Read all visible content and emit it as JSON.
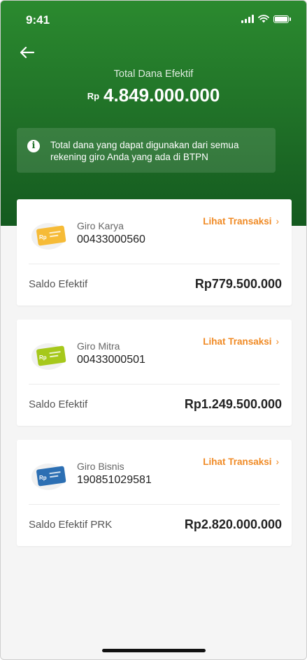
{
  "status_bar": {
    "time": "9:41"
  },
  "header": {
    "total_label": "Total Dana Efektif",
    "currency": "Rp",
    "total_amount": "4.849.000.000",
    "info_text": "Total dana yang dapat digunakan dari semua rekening giro Anda yang ada di BTPN"
  },
  "accounts": [
    {
      "name": "Giro Karya",
      "number": "00433000560",
      "link_label": "Lihat Transaksi",
      "saldo_label": "Saldo Efektif",
      "saldo_value": "Rp779.500.000",
      "card_color": "#f5b21c",
      "card_badge": "Rp"
    },
    {
      "name": "Giro Mitra",
      "number": "00433000501",
      "link_label": "Lihat Transaksi",
      "saldo_label": "Saldo Efektif",
      "saldo_value": "Rp1.249.500.000",
      "card_color": "#a6c81b",
      "card_badge": "Rp"
    },
    {
      "name": "Giro Bisnis",
      "number": "190851029581",
      "link_label": "Lihat Transaksi",
      "saldo_label": "Saldo Efektif PRK",
      "saldo_value": "Rp2.820.000.000",
      "card_color": "#2c6fb3",
      "card_badge": "Rp"
    }
  ],
  "colors": {
    "header_green": "#1f6f27",
    "accent_orange": "#f08a24"
  },
  "icons": {
    "back": "arrow-left-icon",
    "info": "info-icon",
    "chevron": "chevron-right-icon"
  }
}
